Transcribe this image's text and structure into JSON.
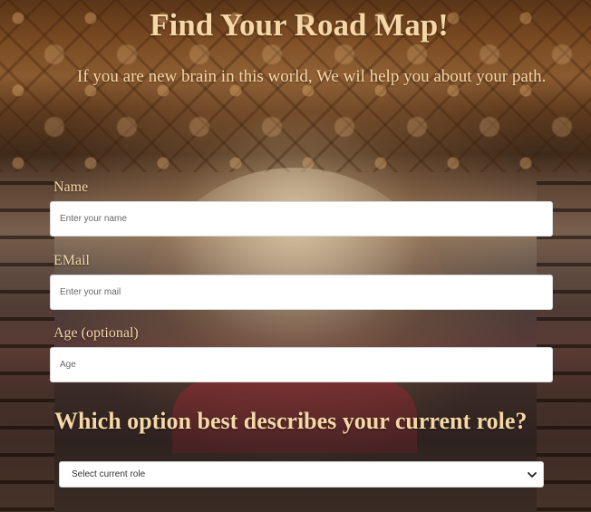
{
  "header": {
    "title": "Find Your Road Map!",
    "subtitle": "If you are new brain in this world, We wil help you about your path."
  },
  "form": {
    "name": {
      "label": "Name",
      "placeholder": "Enter your name",
      "value": ""
    },
    "email": {
      "label": "EMail",
      "placeholder": "Enter your mail",
      "value": ""
    },
    "age": {
      "label": "Age (optional)",
      "placeholder": "Age",
      "value": ""
    },
    "role_question": "Which option best describes your current role?",
    "role_select": {
      "selected": "Select current role",
      "icon": "chevron-down-icon"
    }
  },
  "colors": {
    "accent_text": "#f6d7a6",
    "input_background": "#ffffff"
  }
}
